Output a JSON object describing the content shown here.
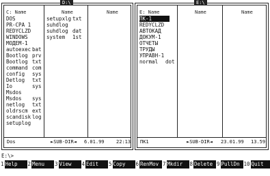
{
  "left_panel": {
    "title": "D:\\",
    "col_headers": [
      "C: Name",
      "Name",
      "Name"
    ],
    "columns": [
      [
        {
          "name": "DOS",
          "ext": ""
        },
        {
          "name": "PR-CPA 1",
          "ext": ""
        },
        {
          "name": "REDYCLZD",
          "ext": ""
        },
        {
          "name": "WINDOWS",
          "ext": ""
        },
        {
          "name": "МОДЕМ-1",
          "ext": ""
        },
        {
          "name": "autoexec",
          "ext": "bat"
        },
        {
          "name": "Bootlog",
          "ext": "prv"
        },
        {
          "name": "Bootlog",
          "ext": "txt"
        },
        {
          "name": "command",
          "ext": "com"
        },
        {
          "name": "config",
          "ext": "sys"
        },
        {
          "name": "Detlog",
          "ext": "txt"
        },
        {
          "name": "Io",
          "ext": "sys"
        },
        {
          "name": "Msdos",
          "ext": ""
        },
        {
          "name": "Msdos",
          "ext": "sys"
        },
        {
          "name": "netlog",
          "ext": "txt"
        },
        {
          "name": "oldrscm",
          "ext": "ext"
        },
        {
          "name": "scandisk",
          "ext": "log"
        },
        {
          "name": "setuplog",
          "ext": ""
        }
      ],
      [
        {
          "name": "setupxlg",
          "ext": "txt"
        },
        {
          "name": "suhdlog",
          "ext": ""
        },
        {
          "name": "suhdlog",
          "ext": "dat"
        },
        {
          "name": "system",
          "ext": "1st"
        }
      ],
      []
    ],
    "status": {
      "name": "Dos",
      "info": "►SUB-DIR◄",
      "date": "6.01.99",
      "time": "22:13"
    }
  },
  "right_panel": {
    "title": "E:\\",
    "col_headers": [
      "E: Name",
      "Name",
      "Name"
    ],
    "columns": [
      [
        {
          "name": "ПК-1",
          "ext": "",
          "selected": true
        },
        {
          "name": "REDYCLZD",
          "ext": ""
        },
        {
          "name": "АВТОКАД",
          "ext": ""
        },
        {
          "name": "ДОКУМ-1",
          "ext": ""
        },
        {
          "name": "ОТЧЕТЫ",
          "ext": ""
        },
        {
          "name": "ТРУДЫ",
          "ext": ""
        },
        {
          "name": "УПРАВН-1",
          "ext": ""
        },
        {
          "name": "normal",
          "ext": "dot"
        }
      ],
      [],
      []
    ],
    "status": {
      "name": "ПК1",
      "info": "►SUB-DIR◄",
      "date": "23.01.99",
      "time": "13.59"
    }
  },
  "prompt": "E:\\>",
  "fkeys": [
    {
      "num": "1",
      "label": "Help"
    },
    {
      "num": "2",
      "label": "Menu"
    },
    {
      "num": "3",
      "label": "View"
    },
    {
      "num": "4",
      "label": "Edit"
    },
    {
      "num": "5",
      "label": "Copy"
    },
    {
      "num": "6",
      "label": "RenMov"
    },
    {
      "num": "7",
      "label": "Mkdir"
    },
    {
      "num": "8",
      "label": "Delete"
    },
    {
      "num": "9",
      "label": "PullDn"
    },
    {
      "num": "10",
      "label": "Quit"
    }
  ]
}
